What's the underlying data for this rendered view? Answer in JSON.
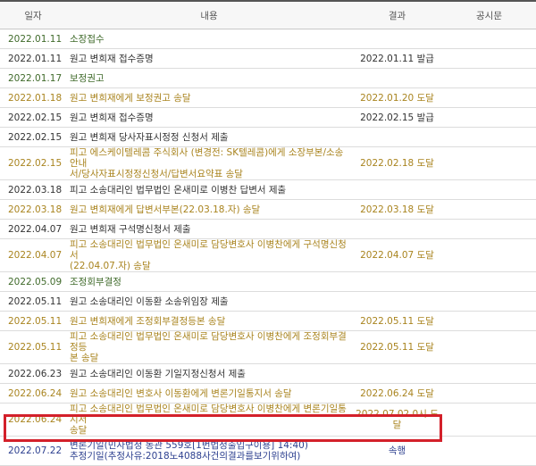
{
  "header": {
    "date": "일자",
    "content": "내용",
    "result": "결과",
    "notice": "공시문"
  },
  "rows": [
    {
      "date": "2022.01.11",
      "content": "소장접수",
      "content2": "",
      "result": "",
      "notice": ""
    },
    {
      "date": "2022.01.11",
      "content": "원고 변희재 접수증명",
      "content2": "",
      "result": "2022.01.11 발급",
      "notice": ""
    },
    {
      "date": "2022.01.17",
      "content": "보정권고",
      "content2": "",
      "result": "",
      "notice": ""
    },
    {
      "date": "2022.01.18",
      "content": "원고 변희재에게 보정권고 송달",
      "content2": "",
      "result": "2022.01.20 도달",
      "notice": ""
    },
    {
      "date": "2022.02.15",
      "content": "원고 변희재 접수증명",
      "content2": "",
      "result": "2022.02.15 발급",
      "notice": ""
    },
    {
      "date": "2022.02.15",
      "content": "원고 변희재 당사자표시정정 신청서 제출",
      "content2": "",
      "result": "",
      "notice": ""
    },
    {
      "date": "2022.02.15",
      "content": "피고 에스케이텔레콤 주식회사 (변경전: SK텔레콤)에게 소장부본/소송안내",
      "content2": "서/당사자표시정정신청서/답변서요약표 송달",
      "result": "2022.02.18 도달",
      "notice": ""
    },
    {
      "date": "2022.03.18",
      "content": "피고 소송대리인 법무법인 온새미로 이병찬 답변서 제출",
      "content2": "",
      "result": "",
      "notice": ""
    },
    {
      "date": "2022.03.18",
      "content": "원고 변희재에게 답변서부본(22.03.18.자) 송달",
      "content2": "",
      "result": "2022.03.18 도달",
      "notice": ""
    },
    {
      "date": "2022.04.07",
      "content": "원고 변희재 구석명신청서 제출",
      "content2": "",
      "result": "",
      "notice": ""
    },
    {
      "date": "2022.04.07",
      "content": "피고 소송대리인 법무법인 온새미로 담당변호사 이병찬에게 구석명신청서",
      "content2": "(22.04.07.자) 송달",
      "result": "2022.04.07 도달",
      "notice": ""
    },
    {
      "date": "2022.05.09",
      "content": "조정회부결정",
      "content2": "",
      "result": "",
      "notice": ""
    },
    {
      "date": "2022.05.11",
      "content": "원고 소송대리인 이동환 소송위임장 제출",
      "content2": "",
      "result": "",
      "notice": ""
    },
    {
      "date": "2022.05.11",
      "content": "원고 변희재에게 조정회부결정등본 송달",
      "content2": "",
      "result": "2022.05.11 도달",
      "notice": ""
    },
    {
      "date": "2022.05.11",
      "content": "피고 소송대리인 법무법인 온새미로 담당변호사 이병찬에게 조정회부결정등",
      "content2": "본 송달",
      "result": "2022.05.11 도달",
      "notice": ""
    },
    {
      "date": "2022.06.23",
      "content": "원고 소송대리인 이동환 기일지정신청서 제출",
      "content2": "",
      "result": "",
      "notice": ""
    },
    {
      "date": "2022.06.24",
      "content": "원고 소송대리인 변호사 이동환에게 변론기일통지서 송달",
      "content2": "",
      "result": "2022.06.24 도달",
      "notice": ""
    },
    {
      "date": "2022.06.24",
      "content": "피고 소송대리인 법무법인 온새미로 담당변호사 이병찬에게 변론기일통지서",
      "content2": "송달",
      "result": "2022.07.02 0시 도달",
      "notice": ""
    },
    {
      "date": "2022.07.22",
      "content": "변론기일(민사법정 동관 559호[1번법정출입구이용] 14:40)",
      "content2": "추정기일(추정사유:2018노4088사건의결과를보기위하여)",
      "result": "속행",
      "notice": ""
    }
  ],
  "colors": {
    "gold": "#a9841f",
    "green": "#3f6a2a",
    "blue": "#2c3f8f",
    "highlight": "#d3202a"
  }
}
